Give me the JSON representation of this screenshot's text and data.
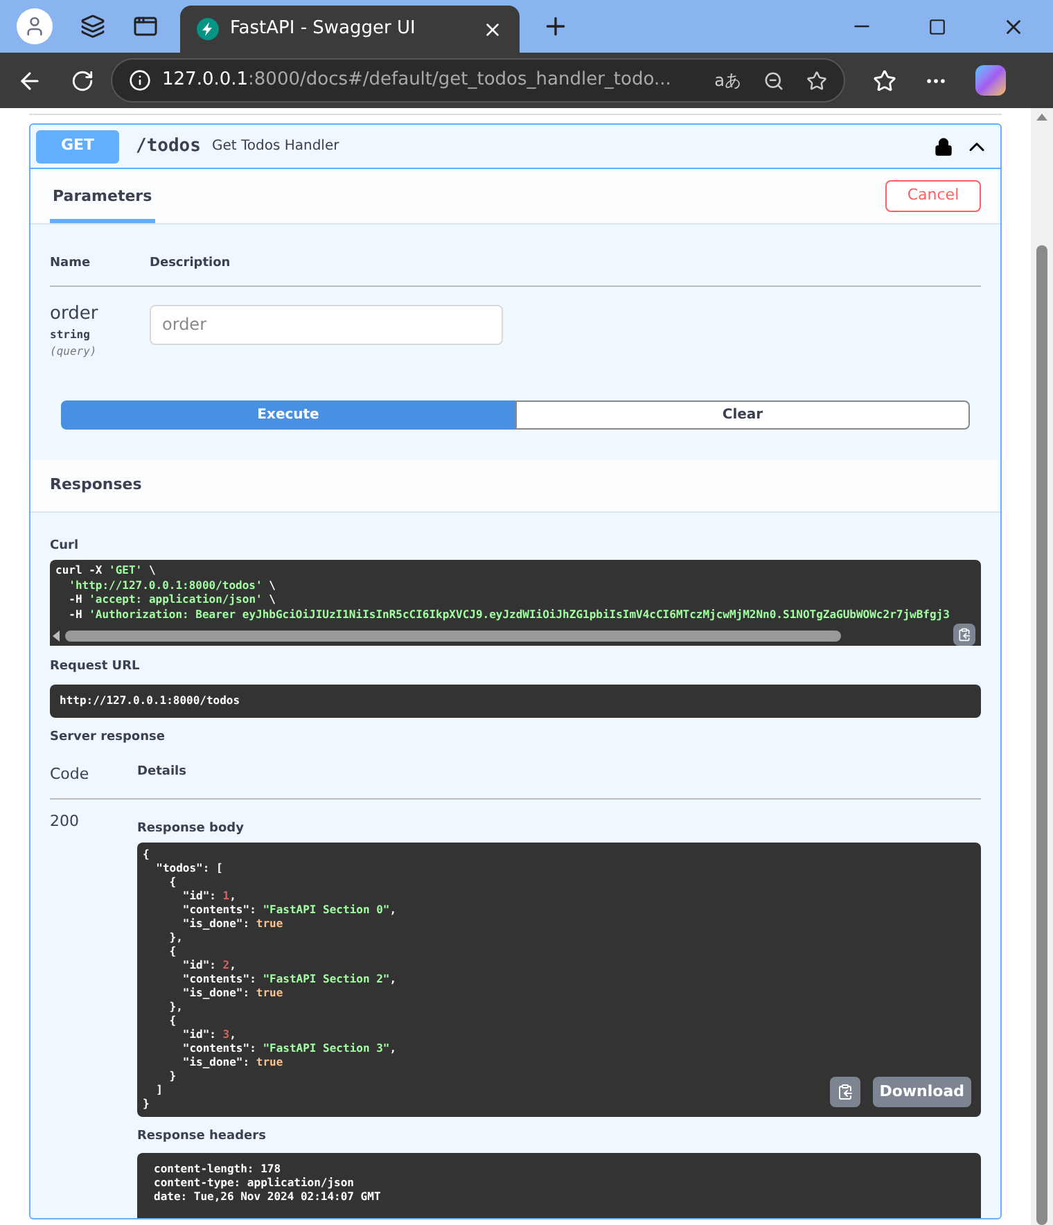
{
  "browser": {
    "tab_title": "FastAPI - Swagger UI",
    "url_host": "127.0.0.1",
    "url_rest": ":8000/docs#/default/get_todos_handler_todo...",
    "translate_glyph": "aあ"
  },
  "operation": {
    "method": "GET",
    "path": "/todos",
    "summary": "Get Todos Handler",
    "expanded": true,
    "locked": true
  },
  "tabs": [
    {
      "label": "Parameters",
      "selected": true
    }
  ],
  "cancel_button": "Cancel",
  "param_columns": [
    "Name",
    "Description"
  ],
  "parameters": [
    {
      "name": "order",
      "type": "string",
      "location": "(query)",
      "placeholder": "order"
    }
  ],
  "actions": [
    {
      "label": "Execute",
      "kind": "primary"
    },
    {
      "label": "Clear",
      "kind": "secondary"
    }
  ],
  "responses_title": "Responses",
  "curl": {
    "label": "Curl",
    "lines": [
      [
        {
          "text": "curl -X ",
          "kind": "plain"
        },
        {
          "text": "'GET'",
          "kind": "string"
        },
        {
          "text": " \\",
          "kind": "plain"
        }
      ],
      [
        {
          "text": "  'http://127.0.0.1:8000/todos'",
          "kind": "string"
        },
        {
          "text": " \\",
          "kind": "plain"
        }
      ],
      [
        {
          "text": "  -H ",
          "kind": "plain"
        },
        {
          "text": "'accept: application/json'",
          "kind": "string"
        },
        {
          "text": " \\",
          "kind": "plain"
        }
      ],
      [
        {
          "text": "  -H ",
          "kind": "plain"
        },
        {
          "text": "'Authorization: Bearer eyJhbGciOiJIUzI1NiIsInR5cCI6IkpXVCJ9.eyJzdWIiOiJhZG1pbiIsImV4cCI6MTczMjcwMjM2Nn0.S1NOTgZaGUbWOWc2r7jwBfgj3",
          "kind": "string"
        }
      ]
    ]
  },
  "request_url": {
    "label": "Request URL",
    "value": "http://127.0.0.1:8000/todos"
  },
  "server_response": {
    "label": "Server response",
    "columns": [
      "Code",
      "Details"
    ],
    "code": "200",
    "body_label": "Response body",
    "body_lines": [
      [
        {
          "text": "{",
          "kind": "punct"
        }
      ],
      [
        {
          "text": "  \"todos\": [",
          "kind": "punct"
        }
      ],
      [
        {
          "text": "    {",
          "kind": "punct"
        }
      ],
      [
        {
          "text": "      \"id\": ",
          "kind": "punct"
        },
        {
          "text": "1",
          "kind": "number"
        },
        {
          "text": ",",
          "kind": "punct"
        }
      ],
      [
        {
          "text": "      \"contents\": ",
          "kind": "punct"
        },
        {
          "text": "\"FastAPI Section 0\"",
          "kind": "string"
        },
        {
          "text": ",",
          "kind": "punct"
        }
      ],
      [
        {
          "text": "      \"is_done\": ",
          "kind": "punct"
        },
        {
          "text": "true",
          "kind": "bool"
        }
      ],
      [
        {
          "text": "    },",
          "kind": "punct"
        }
      ],
      [
        {
          "text": "    {",
          "kind": "punct"
        }
      ],
      [
        {
          "text": "      \"id\": ",
          "kind": "punct"
        },
        {
          "text": "2",
          "kind": "number"
        },
        {
          "text": ",",
          "kind": "punct"
        }
      ],
      [
        {
          "text": "      \"contents\": ",
          "kind": "punct"
        },
        {
          "text": "\"FastAPI Section 2\"",
          "kind": "string"
        },
        {
          "text": ",",
          "kind": "punct"
        }
      ],
      [
        {
          "text": "      \"is_done\": ",
          "kind": "punct"
        },
        {
          "text": "true",
          "kind": "bool"
        }
      ],
      [
        {
          "text": "    },",
          "kind": "punct"
        }
      ],
      [
        {
          "text": "    {",
          "kind": "punct"
        }
      ],
      [
        {
          "text": "      \"id\": ",
          "kind": "punct"
        },
        {
          "text": "3",
          "kind": "number"
        },
        {
          "text": ",",
          "kind": "punct"
        }
      ],
      [
        {
          "text": "      \"contents\": ",
          "kind": "punct"
        },
        {
          "text": "\"FastAPI Section 3\"",
          "kind": "string"
        },
        {
          "text": ",",
          "kind": "punct"
        }
      ],
      [
        {
          "text": "      \"is_done\": ",
          "kind": "punct"
        },
        {
          "text": "true",
          "kind": "bool"
        }
      ],
      [
        {
          "text": "    }",
          "kind": "punct"
        }
      ],
      [
        {
          "text": "  ]",
          "kind": "punct"
        }
      ],
      [
        {
          "text": "}",
          "kind": "punct"
        }
      ]
    ],
    "download_button": "Download",
    "headers_label": "Response headers",
    "headers": [
      "content-length: 178",
      "content-type: application/json",
      "date: Tue,26 Nov 2024 02:14:07 GMT"
    ]
  }
}
